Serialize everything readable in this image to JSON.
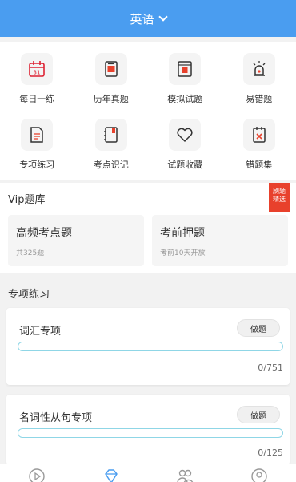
{
  "header": {
    "title": "英语"
  },
  "grid": [
    {
      "label": "每日一练",
      "icon": "calendar-icon"
    },
    {
      "label": "历年真题",
      "icon": "exam-paper-icon"
    },
    {
      "label": "模拟试题",
      "icon": "mock-test-icon"
    },
    {
      "label": "易错题",
      "icon": "alert-icon"
    },
    {
      "label": "专项练习",
      "icon": "document-icon"
    },
    {
      "label": "考点识记",
      "icon": "notebook-icon"
    },
    {
      "label": "试题收藏",
      "icon": "heart-icon"
    },
    {
      "label": "错题集",
      "icon": "mistake-book-icon"
    }
  ],
  "vip": {
    "title": "Vip题库",
    "badge": "刷题 精选",
    "cards": [
      {
        "title": "高频考点题",
        "sub": "共325题"
      },
      {
        "title": "考前押题",
        "sub": "考前10天开放"
      }
    ]
  },
  "practice": {
    "title": "专项练习",
    "items": [
      {
        "name": "词汇专项",
        "button": "做题",
        "count": "0/751",
        "progress": 0
      },
      {
        "name": "名词性从句专项",
        "button": "做题",
        "count": "0/125",
        "progress": 0
      }
    ]
  },
  "tabs": [
    {
      "icon": "play-icon"
    },
    {
      "icon": "diamond-icon"
    },
    {
      "icon": "community-icon"
    },
    {
      "icon": "profile-icon"
    }
  ],
  "colors": {
    "accent": "#4a9df0",
    "badge": "#e8412c",
    "progress_track": "#8fd6e6"
  }
}
